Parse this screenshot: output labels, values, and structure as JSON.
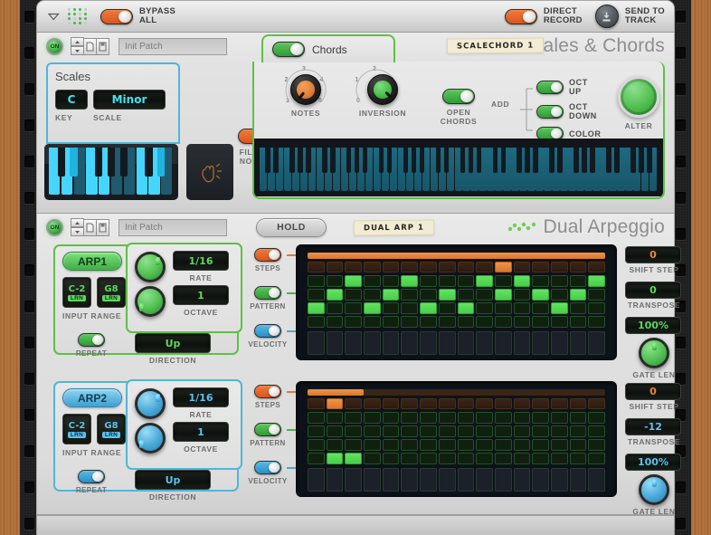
{
  "transport": {
    "expand_icon": "triangle-down-icon",
    "logo_icon": "dots-logo-icon",
    "bypass_line1": "BYPASS",
    "bypass_line2": "ALL",
    "direct_line1": "DIRECT",
    "direct_line2": "RECORD",
    "send_line1": "SEND TO",
    "send_line2": "TRACK",
    "bypass_state": "on",
    "direct_record_state": "on"
  },
  "scales_device": {
    "power_label": "ON",
    "patch_name": "Init Patch",
    "tab_label": "Chords",
    "tab_toggle_state": "on",
    "tape_label": "SCALECHORD 1",
    "brand_name": "Scales & Chords",
    "scales": {
      "title": "Scales",
      "key_value": "C",
      "key_caption": "KEY",
      "scale_value": "Minor",
      "scale_caption": "SCALE"
    },
    "filter_notes": {
      "line1": "FILTER",
      "line2": "NOTES",
      "state": "on"
    },
    "notes_knob": {
      "caption": "NOTES",
      "value": 4,
      "ticks": [
        "1",
        "2",
        "3",
        "4",
        "5"
      ]
    },
    "inversion_knob": {
      "caption": "INVERSION",
      "value": 0,
      "ticks": [
        "0",
        "1",
        "2",
        "3",
        "4"
      ]
    },
    "open_chords": {
      "line1": "OPEN",
      "line2": "CHORDS",
      "state": "on"
    },
    "add_label": "ADD",
    "add_toggles": [
      {
        "label": "OCT UP",
        "state": "on"
      },
      {
        "label": "OCT DOWN",
        "state": "on"
      },
      {
        "label": "COLOR",
        "state": "on"
      }
    ],
    "alter_knob": {
      "caption": "ALTER"
    },
    "mini_keyboard_active_notes": [
      0,
      2,
      3,
      5,
      7
    ],
    "mini_keyboard_name": "scale-keyboard",
    "hand_icon": "hand-mute-icon",
    "big_keyboard_name": "chord-keyboard"
  },
  "arp_device": {
    "power_label": "ON",
    "patch_name": "Init Patch",
    "hold_label": "HOLD",
    "tape_label": "DUAL ARP 1",
    "brand_name": "Dual Arpeggio",
    "arps": [
      {
        "name": "ARP1",
        "accent": "#5cc143",
        "input_range": {
          "caption": "INPUT RANGE",
          "low": "C-2",
          "high": "G8",
          "learn": "LRN"
        },
        "rate": {
          "caption": "RATE",
          "value": "1/16"
        },
        "octave": {
          "caption": "OCTAVE",
          "value": "1"
        },
        "repeat": {
          "caption": "REPEAT",
          "state": "on"
        },
        "direction": {
          "caption": "DIRECTION",
          "value": "Up"
        },
        "lanes": [
          {
            "label": "STEPS",
            "state": "on",
            "color": "#e07a38"
          },
          {
            "label": "PATTERN",
            "state": "on",
            "color": "#46b846"
          },
          {
            "label": "VELOCITY",
            "state": "on",
            "color": "#49a9d8"
          }
        ],
        "shift_step": {
          "caption": "SHIFT STEP",
          "value": "0",
          "color": "#e8883c"
        },
        "transpose": {
          "caption": "TRANSPOSE",
          "value": "0",
          "color": "#5fd65f"
        },
        "gate_len": {
          "caption": "GATE LEN",
          "value": "100%",
          "color": "#5fd65f"
        },
        "grid": {
          "steps": 16,
          "bar_fill_steps": 16,
          "step_on": [
            11
          ],
          "pattern_rows": [
            [
              3,
              6,
              10,
              12,
              16
            ],
            [
              2,
              5,
              8,
              11,
              13,
              15
            ],
            [
              1,
              4,
              7,
              9,
              14
            ],
            []
          ]
        }
      },
      {
        "name": "ARP2",
        "accent": "#4fb6d9",
        "input_range": {
          "caption": "INPUT RANGE",
          "low": "C-2",
          "high": "G8",
          "learn": "LRN"
        },
        "rate": {
          "caption": "RATE",
          "value": "1/16"
        },
        "octave": {
          "caption": "OCTAVE",
          "value": "1"
        },
        "repeat": {
          "caption": "REPEAT",
          "state": "on"
        },
        "direction": {
          "caption": "DIRECTION",
          "value": "Up"
        },
        "lanes": [
          {
            "label": "STEPS",
            "state": "on",
            "color": "#e07a38"
          },
          {
            "label": "PATTERN",
            "state": "on",
            "color": "#46b846"
          },
          {
            "label": "VELOCITY",
            "state": "on",
            "color": "#49a9d8"
          }
        ],
        "shift_step": {
          "caption": "SHIFT STEP",
          "value": "0",
          "color": "#e8883c"
        },
        "transpose": {
          "caption": "TRANSPOSE",
          "value": "-12",
          "color": "#5cc2ee"
        },
        "gate_len": {
          "caption": "GATE LEN",
          "value": "100%",
          "color": "#5cc2ee"
        },
        "grid": {
          "steps": 16,
          "bar_fill_steps": 3,
          "step_on": [
            2
          ],
          "pattern_rows": [
            [],
            [],
            [],
            [
              2,
              3
            ]
          ]
        }
      }
    ]
  }
}
